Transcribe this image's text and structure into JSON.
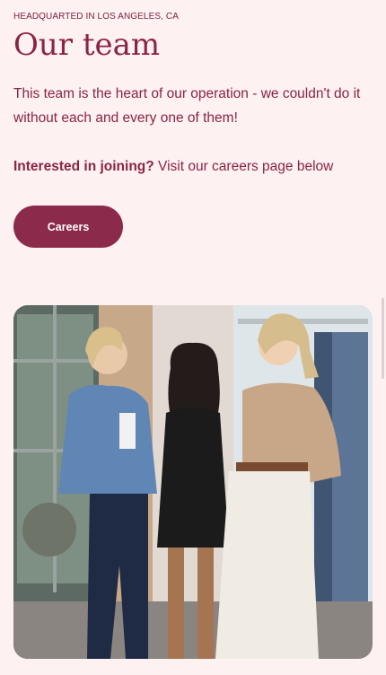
{
  "header": {
    "eyebrow": "HEADQUARTED IN LOS ANGELES, CA",
    "title": "Our team"
  },
  "intro": {
    "description": "This team is the heart of our operation - we couldn't do it without each and every one of them!",
    "join_bold": "Interested in joining?",
    "join_rest": " Visit our careers page below"
  },
  "cta": {
    "label": "Careers"
  },
  "colors": {
    "background": "#fdf1f1",
    "text": "#8a2446",
    "button": "#8c2a4b"
  }
}
